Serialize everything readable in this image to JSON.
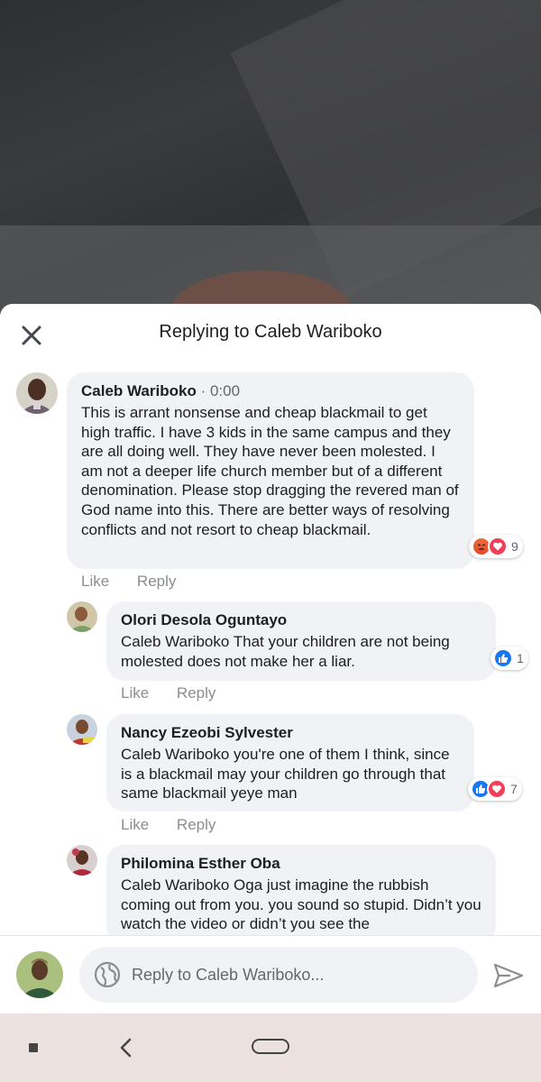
{
  "header": {
    "title": "Replying to Caleb Wariboko",
    "close_icon": "close-icon"
  },
  "comments": [
    {
      "author": "Caleb Wariboko",
      "time": "· 0:00",
      "text": "This is arrant nonsense and cheap blackmail to get high traffic. I have 3 kids in the same campus and they are all doing well. They have never been molested. I am not a deeper life church member but of a different denomination. Please stop dragging the revered man of God name into this. There are better ways of resolving conflicts and not resort to cheap blackmail.",
      "reactions": [
        "angry",
        "love"
      ],
      "reaction_count": "9",
      "like_label": "Like",
      "reply_label": "Reply"
    },
    {
      "author": "Olori Desola Oguntayo",
      "text": "Caleb Wariboko That your children are not being molested does not make her a liar.",
      "reactions": [
        "like"
      ],
      "reaction_count": "1",
      "like_label": "Like",
      "reply_label": "Reply"
    },
    {
      "author": "Nancy Ezeobi Sylvester",
      "text": "Caleb Wariboko you're one of them I think, since is a blackmail may your children go through that same blackmail yeye man",
      "reactions": [
        "like",
        "love"
      ],
      "reaction_count": "7",
      "like_label": "Like",
      "reply_label": "Reply"
    },
    {
      "author": "Philomina Esther Oba",
      "text": "Caleb Wariboko Oga just imagine the rubbish coming out from you. you sound so stupid. Didn’t you watch the video or didn’t you see the"
    }
  ],
  "composer": {
    "placeholder": "Reply to Caleb Wariboko...",
    "globe_icon": "globe-icon",
    "send_icon": "send-icon"
  },
  "colors": {
    "bubble": "#f0f2f5",
    "like_blue": "#1877f2",
    "love_red": "#f33e58",
    "muted_text": "#8a8d91",
    "navbar": "#ebe1df"
  }
}
